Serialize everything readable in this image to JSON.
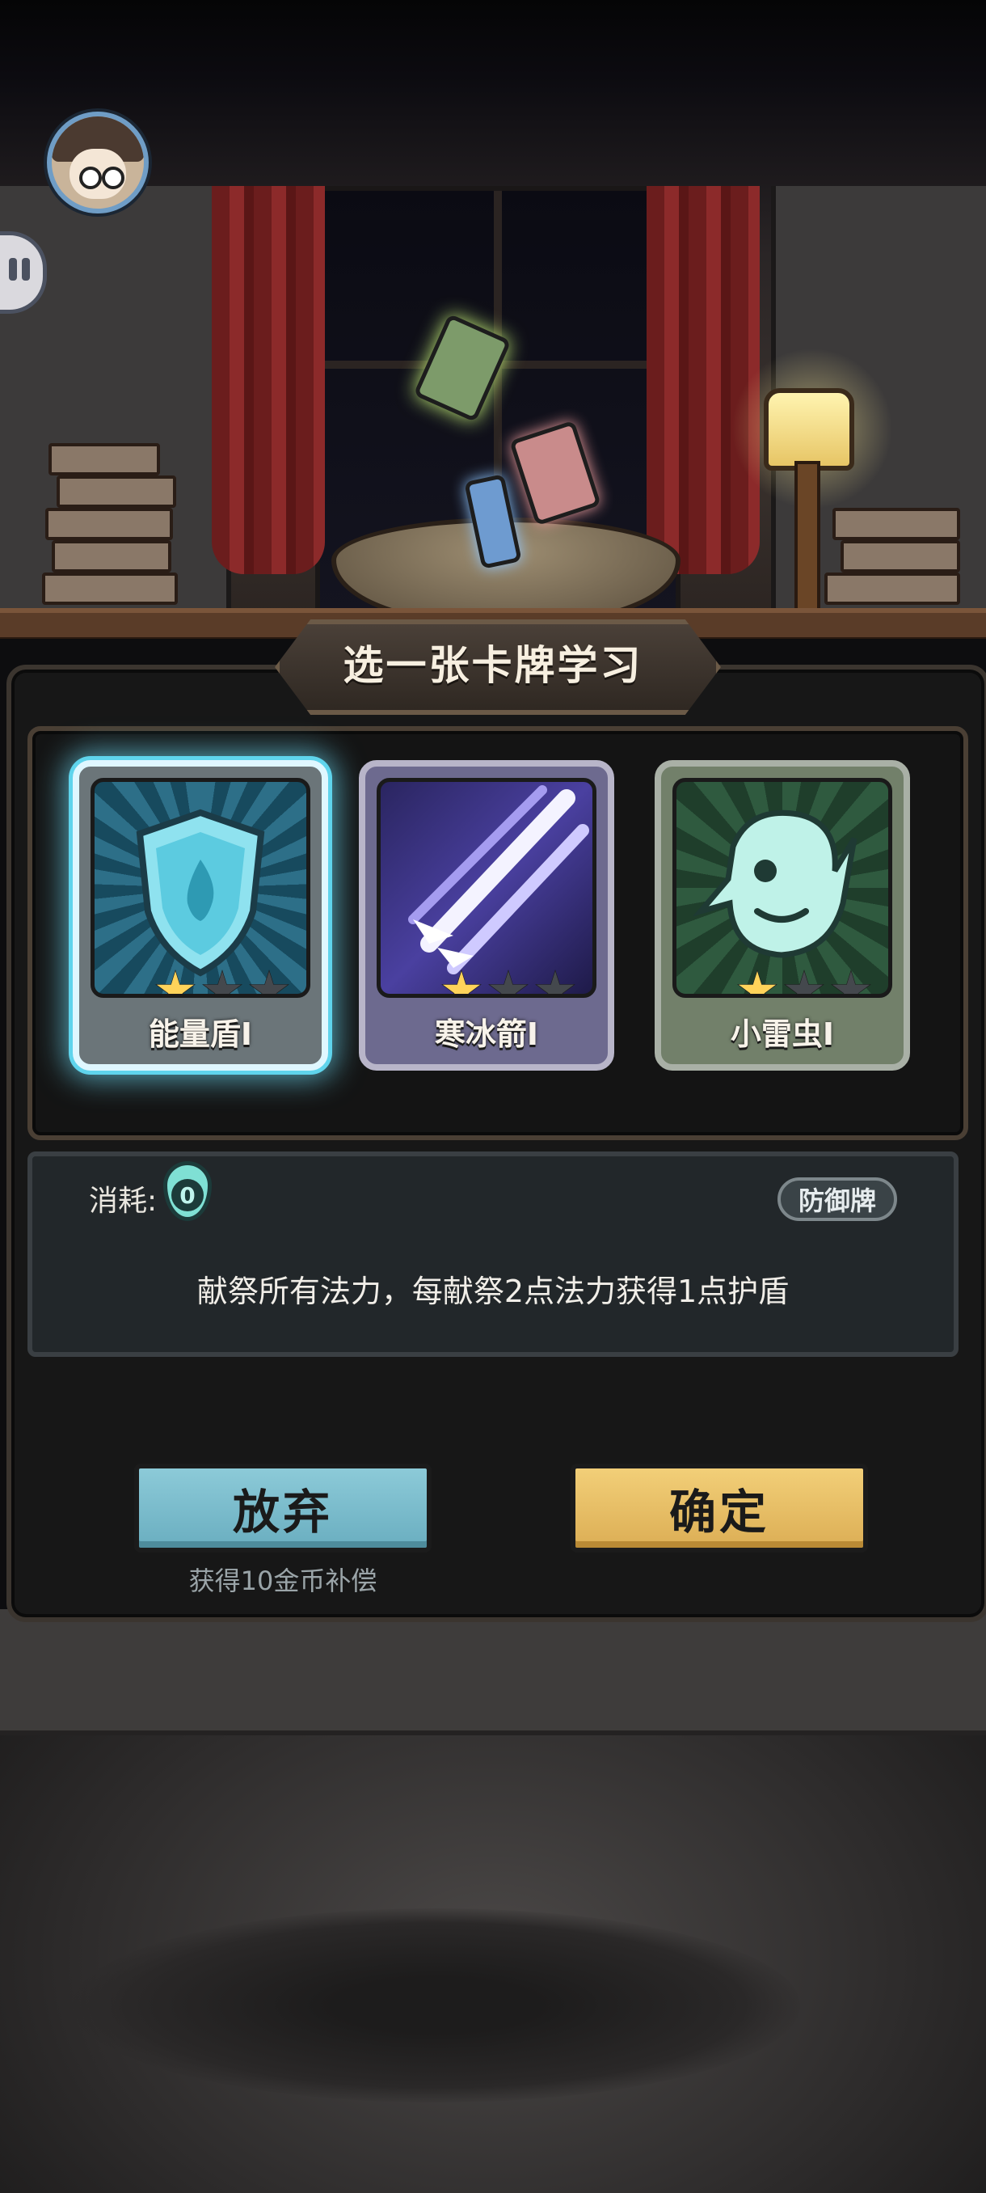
{
  "title": "选一张卡牌学习",
  "cards": [
    {
      "name": "能量盾I",
      "stars_filled": 1,
      "stars_total": 3,
      "selected": true,
      "art_icon": "shield-flame-icon",
      "accent": "#5fd4ec"
    },
    {
      "name": "寒冰箭I",
      "stars_filled": 1,
      "stars_total": 3,
      "selected": false,
      "art_icon": "ice-arrows-icon",
      "accent": "#8a7de0"
    },
    {
      "name": "小雷虫I",
      "stars_filled": 1,
      "stars_total": 3,
      "selected": false,
      "art_icon": "thunder-bug-icon",
      "accent": "#7fd6b6"
    }
  ],
  "detail": {
    "cost_label": "消耗:",
    "cost_value": "0",
    "type_badge": "防御牌",
    "description": "献祭所有法力，每献祭2点法力获得1点护盾"
  },
  "buttons": {
    "abandon_label": "放弃",
    "abandon_note": "获得10金币补偿",
    "confirm_label": "确定"
  },
  "colors": {
    "abandon_button": "#7bbccd",
    "confirm_button": "#e8bf66",
    "selected_glow": "#5fd4ec"
  }
}
